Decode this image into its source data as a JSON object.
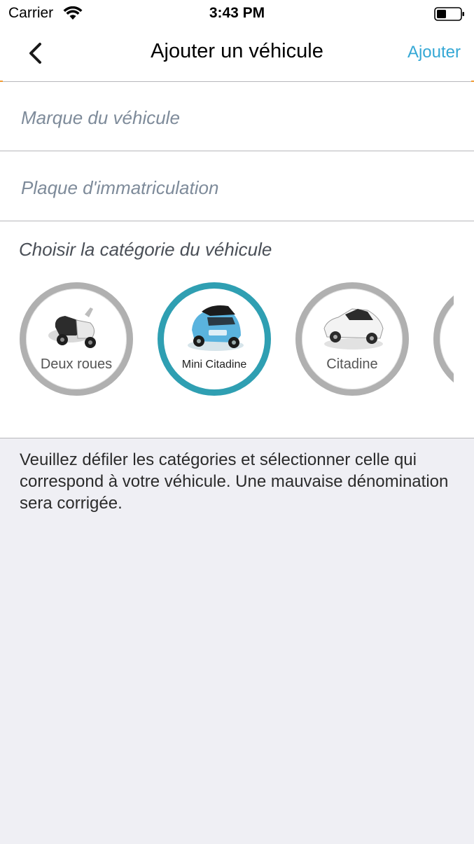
{
  "status": {
    "carrier": "Carrier",
    "time": "3:43 PM"
  },
  "nav": {
    "title": "Ajouter un véhicule",
    "add_label": "Ajouter"
  },
  "form": {
    "brand_placeholder": "Marque du véhicule",
    "plate_placeholder": "Plaque d'immatriculation",
    "category_heading": "Choisir la catégorie du véhicule",
    "categories": [
      {
        "label": "Deux roues",
        "icon": "scooter-icon",
        "selected": false
      },
      {
        "label": "Mini Citadine",
        "icon": "mini-car-icon",
        "selected": true
      },
      {
        "label": "Citadine",
        "icon": "car-icon",
        "selected": false
      }
    ]
  },
  "help": "Veuillez défiler les catégories et sélectionner celle qui correspond à votre véhicule. Une mauvaise dénomination sera corrigée.",
  "colors": {
    "accent": "#35a8d5",
    "selected_ring": "#2f9fb2",
    "background": "#efeff4"
  }
}
